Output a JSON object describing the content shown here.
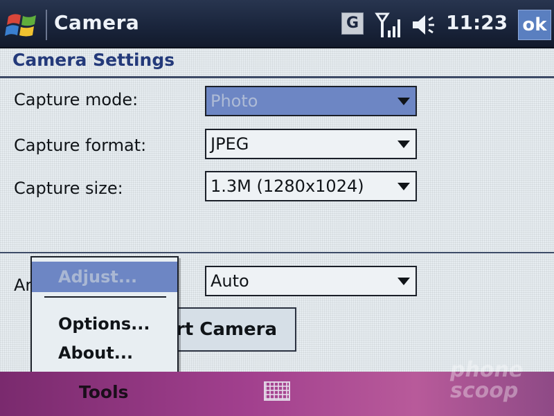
{
  "statusbar": {
    "app_title": "Camera",
    "network_badge": "G",
    "clock": "11:23",
    "ok_label": "ok",
    "icons": [
      "windows-start-icon",
      "signal-icon",
      "volume-icon"
    ]
  },
  "settings": {
    "header": "Camera Settings",
    "capture_mode": {
      "label": "Capture mode:",
      "value": "Photo"
    },
    "capture_format": {
      "label": "Capture format:",
      "value": "JPEG"
    },
    "capture_size": {
      "label": "Capture size:",
      "value": "1.3M (1280x1024)"
    },
    "ambient": {
      "label_partial": "Ar",
      "value": "Auto"
    },
    "start_camera_label": "rt Camera"
  },
  "popup_menu": {
    "items": [
      {
        "label": "Adjust...",
        "highlighted": true
      },
      {
        "label": "Options..."
      },
      {
        "label": "About..."
      }
    ]
  },
  "menubar": {
    "tools_label": "Tools",
    "keyboard_icon": "keyboard-icon"
  },
  "watermark": {
    "line1": "phone",
    "line2": "scoop"
  },
  "colors": {
    "titlebar": "#1a253c",
    "header_text": "#243a7a",
    "selection": "#6d86c4",
    "menubar": "#a2408e"
  }
}
